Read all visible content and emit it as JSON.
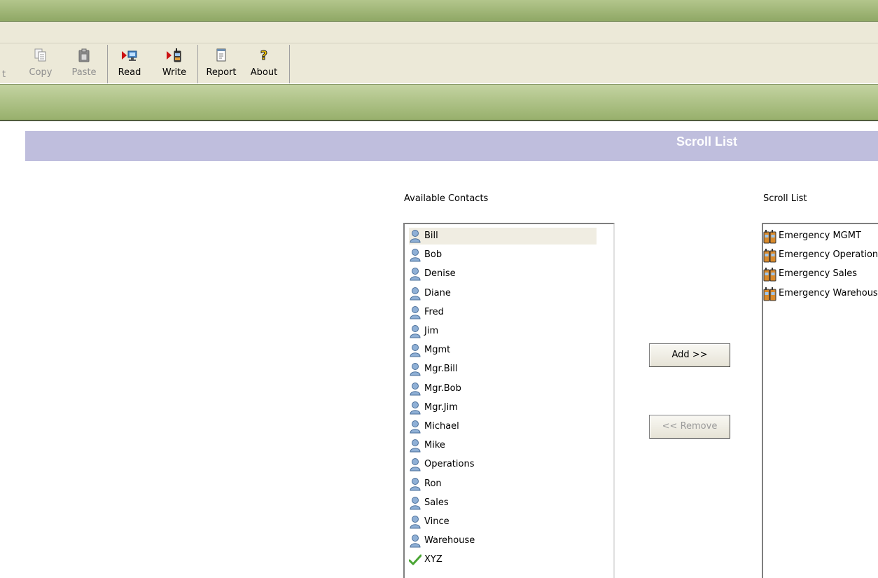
{
  "window": {
    "title_fragment": ""
  },
  "toolbar": {
    "buttons": [
      {
        "label": "Copy",
        "icon": "copy-icon",
        "enabled": false
      },
      {
        "label": "Paste",
        "icon": "paste-icon",
        "enabled": false
      },
      {
        "label": "Read",
        "icon": "read-radio-icon",
        "enabled": true
      },
      {
        "label": "Write",
        "icon": "write-radio-icon",
        "enabled": true
      },
      {
        "label": "Report",
        "icon": "report-icon",
        "enabled": true
      },
      {
        "label": "About",
        "icon": "help-icon",
        "enabled": true
      }
    ],
    "clipped_label": "t"
  },
  "section": {
    "title": "Scroll List"
  },
  "available": {
    "label": "Available Contacts",
    "items": [
      {
        "name": "Bill",
        "icon": "person-icon",
        "selected": true
      },
      {
        "name": "Bob",
        "icon": "person-icon"
      },
      {
        "name": "Denise",
        "icon": "person-icon"
      },
      {
        "name": "Diane",
        "icon": "person-icon"
      },
      {
        "name": "Fred",
        "icon": "person-icon"
      },
      {
        "name": "Jim",
        "icon": "person-icon"
      },
      {
        "name": "Mgmt",
        "icon": "person-icon"
      },
      {
        "name": "Mgr.Bill",
        "icon": "person-icon"
      },
      {
        "name": "Mgr.Bob",
        "icon": "person-icon"
      },
      {
        "name": "Mgr.Jim",
        "icon": "person-icon"
      },
      {
        "name": "Michael",
        "icon": "person-icon"
      },
      {
        "name": "Mike",
        "icon": "person-icon"
      },
      {
        "name": "Operations",
        "icon": "person-icon"
      },
      {
        "name": "Ron",
        "icon": "person-icon"
      },
      {
        "name": "Sales",
        "icon": "person-icon"
      },
      {
        "name": "Vince",
        "icon": "person-icon"
      },
      {
        "name": "Warehouse",
        "icon": "person-icon"
      },
      {
        "name": "XYZ",
        "icon": "checkmark-icon"
      }
    ]
  },
  "actions": {
    "add_label": "Add >>",
    "remove_label": "<< Remove",
    "remove_enabled": false
  },
  "scroll_list": {
    "label": "Scroll List",
    "items": [
      {
        "name": "Emergency MGMT",
        "icon": "radio-group-icon"
      },
      {
        "name": "Emergency Operations",
        "icon": "radio-group-icon"
      },
      {
        "name": "Emergency Sales",
        "icon": "radio-group-icon"
      },
      {
        "name": "Emergency Warehouse",
        "icon": "radio-group-icon"
      }
    ]
  }
}
